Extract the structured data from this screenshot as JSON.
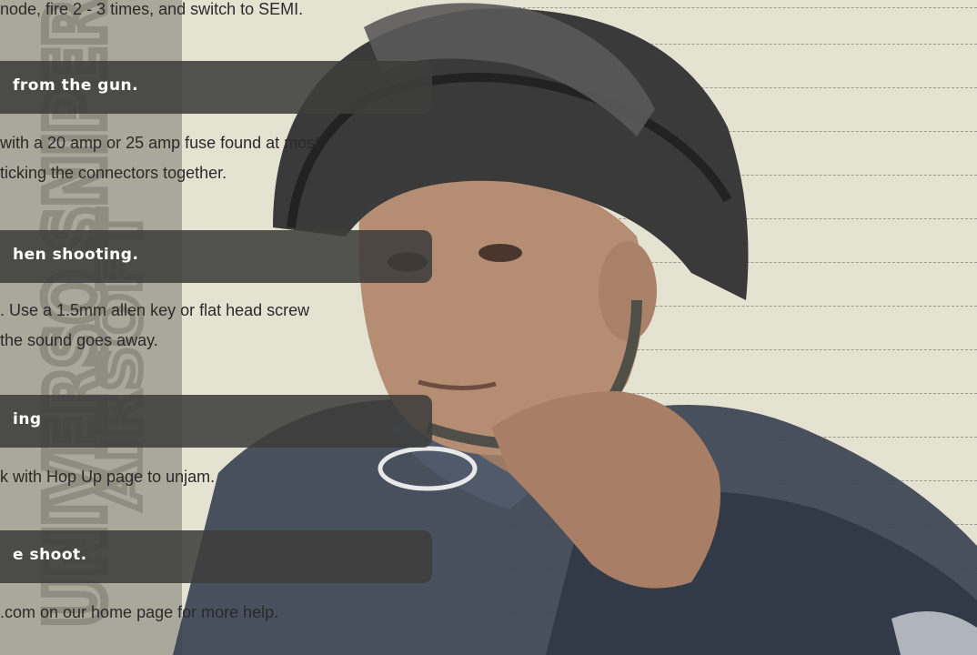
{
  "watermark": {
    "line1": "UNIVERSO SNIPER",
    "line2": "AIRSOFT"
  },
  "rules": {
    "count": 14
  },
  "sections": [
    {
      "body_lines": [
        "node, fire 2 - 3 times, and switch to SEMI."
      ]
    },
    {
      "heading": "from the gun.",
      "body_lines": [
        "with a 20 amp or 25 amp fuse found at most",
        "ticking the connectors together."
      ]
    },
    {
      "heading": "hen shooting.",
      "body_lines": [
        ". Use a 1.5mm allen key or flat head screw",
        " the sound goes away."
      ]
    },
    {
      "heading": "ing",
      "body_lines": [
        "k with Hop Up page to unjam."
      ]
    },
    {
      "heading": "e shoot.",
      "body_lines": [
        ".com on our home page for more help."
      ]
    }
  ],
  "colors": {
    "background": "#e4e2d0",
    "band": "#a9a89a",
    "heading_bar": "#3e3e3c",
    "heading_text": "#ffffff",
    "body_text": "#2a2a2a"
  }
}
